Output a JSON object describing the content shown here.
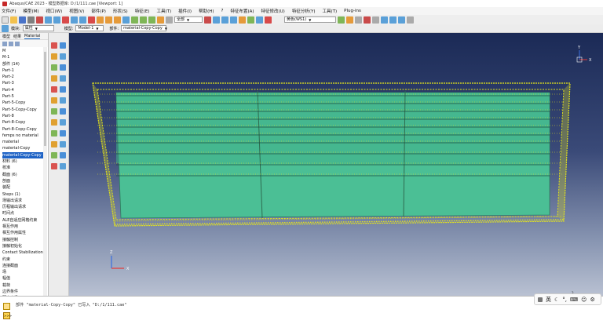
{
  "window": {
    "title": "Abaqus/CAE 2023 - 模型数据库: D:/1/111.cae [Viewport: 1]"
  },
  "menu": {
    "items": [
      "文件(F)",
      "模型(M)",
      "视口(W)",
      "视图(V)",
      "部件(P)",
      "形状(S)",
      "特征(E)",
      "工具(T)",
      "插件(I)",
      "帮助(H)",
      "?",
      "特征布置(A)",
      "特征修改(U)",
      "特征分析(Y)",
      "工具(T)",
      "Plug-ins"
    ]
  },
  "toolbar": {
    "combo_all": "全部",
    "combo_render": "黄色(WS1)",
    "zoom_combo": "2"
  },
  "context": {
    "module_label": "模块:",
    "module_value": "属性",
    "model_label": "模型:",
    "model_value": "Model-1",
    "part_label": "部件:",
    "part_value": "material-Copy-Copy"
  },
  "left_panel": {
    "tabs": [
      "模型",
      "结果",
      "Material"
    ],
    "tree": [
      "M",
      "M-1",
      "部件 (14)",
      "Part-1",
      "Part-2",
      "Part-3",
      "Part-4",
      "Part-5",
      "Part-5-Copy",
      "Part-5-Copy-Copy",
      "Part-8",
      "Part-8-Copy",
      "Part-8-Copy-Copy",
      "femps no material",
      "material",
      "material-Copy",
      "material-Copy-Copy",
      "材料 (6)",
      "校准",
      "截面 (6)",
      "剖面",
      "装配",
      "Steps (1)",
      "场输出请求",
      "历程输出请求",
      "时间点",
      "ALE自适应网格约束",
      "相互作用",
      "相互作用属性",
      "接触控制",
      "接触初始化",
      "Contact Stabilization",
      "约束",
      "连接截面",
      "场",
      "幅值",
      "载荷",
      "边界条件",
      "预定义场"
    ],
    "selected_index": 16
  },
  "viewport": {
    "triad_axes": [
      "X",
      "Y",
      "Z"
    ],
    "csys_axes": [
      "X",
      "Y",
      "Z"
    ]
  },
  "message": {
    "line": "部件 \"material-Copy-Copy\" 已写入 \"D:/1/111.cae\""
  },
  "ime": {
    "lang": "英",
    "top_num": "3"
  },
  "colors": {
    "viewport_top": "#1b2a56",
    "viewport_bottom": "#b9c1d2",
    "part_fill": "#4bbf95",
    "mesh_edge": "#e6e61a",
    "selection_blue": "#1e63c6"
  }
}
